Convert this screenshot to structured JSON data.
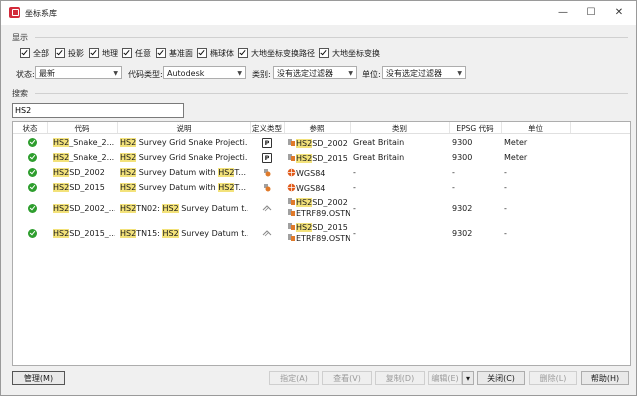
{
  "window": {
    "title": "坐标系库",
    "minimize": "—",
    "maximize": "☐",
    "close": "✕"
  },
  "display": {
    "label": "显示",
    "checkboxes": [
      "全部",
      "投影",
      "地理",
      "任意",
      "基准面",
      "椭球体",
      "大地坐标变换路径",
      "大地坐标变换"
    ]
  },
  "filters": {
    "status_label": "状态:",
    "status_value": "最新",
    "code_type_label": "代码类型:",
    "code_type_value": "Autodesk",
    "category_label": "类别:",
    "category_value": "没有选定过滤器",
    "unit_label": "单位:",
    "unit_value": "没有选定过滤器"
  },
  "search": {
    "label": "搜索",
    "value": "HS2"
  },
  "table": {
    "headers": [
      "状态",
      "代码",
      "说明",
      "定义类型",
      "参照",
      "类别",
      "EPSG 代码",
      "单位"
    ],
    "rows": [
      {
        "code_hl": "HS2",
        "code_rest": "_Snake_2...",
        "desc_hl": "HS2",
        "desc_rest": " Survey Grid Snake Projecti...",
        "type_icon": "P",
        "ref1_hl": "HS2",
        "ref1_rest": "SD_2002",
        "category": "Great Britain",
        "epsg": "9300",
        "unit": "Meter"
      },
      {
        "code_hl": "HS2",
        "code_rest": "_Snake_2...",
        "desc_hl": "HS2",
        "desc_rest": " Survey Grid Snake Projecti...",
        "type_icon": "P",
        "ref1_hl": "HS2",
        "ref1_rest": "SD_2015",
        "category": "Great Britain",
        "epsg": "9300",
        "unit": "Meter"
      },
      {
        "code_hl": "HS2",
        "code_rest": "SD_2002",
        "desc_hl": "HS2",
        "desc_mid": " Survey Datum with ",
        "desc_hl2": "HS2",
        "desc_rest": "T...",
        "ref1_plain": "WGS84",
        "category": "-",
        "epsg": "-",
        "unit": "-"
      },
      {
        "code_hl": "HS2",
        "code_rest": "SD_2015",
        "desc_hl": "HS2",
        "desc_mid": " Survey Datum with ",
        "desc_hl2": "HS2",
        "desc_rest": "T...",
        "ref1_plain": "WGS84",
        "category": "-",
        "epsg": "-",
        "unit": "-"
      },
      {
        "code_hl": "HS2",
        "code_rest": "SD_2002_...",
        "desc_hl": "HS2",
        "desc_mid": "TN02: ",
        "desc_hl2": "HS2",
        "desc_rest": " Survey Datum t...",
        "ref1_hl": "HS2",
        "ref1_rest": "SD_2002",
        "ref2": "ETRF89.OSTN",
        "category": "-",
        "epsg": "9302",
        "unit": "-"
      },
      {
        "code_hl": "HS2",
        "code_rest": "SD_2015_...",
        "desc_hl": "HS2",
        "desc_mid": "TN15: ",
        "desc_hl2": "HS2",
        "desc_rest": " Survey Datum t...",
        "ref1_hl": "HS2",
        "ref1_rest": "SD_2015",
        "ref2": "ETRF89.OSTN",
        "category": "-",
        "epsg": "9302",
        "unit": "-"
      }
    ]
  },
  "buttons": {
    "manage": "管理(M)",
    "assign": "指定(A)",
    "view": "查看(V)",
    "copy": "复制(D)",
    "edit": "编辑(E)",
    "edit_dropdown": "▾",
    "close": "关闭(C)",
    "delete": "删除(L)",
    "help": "帮助(H)"
  },
  "colors": {
    "highlight": "#f3e27a",
    "status_ok": "#2e9e2e",
    "app_icon": "#d32a3a"
  }
}
